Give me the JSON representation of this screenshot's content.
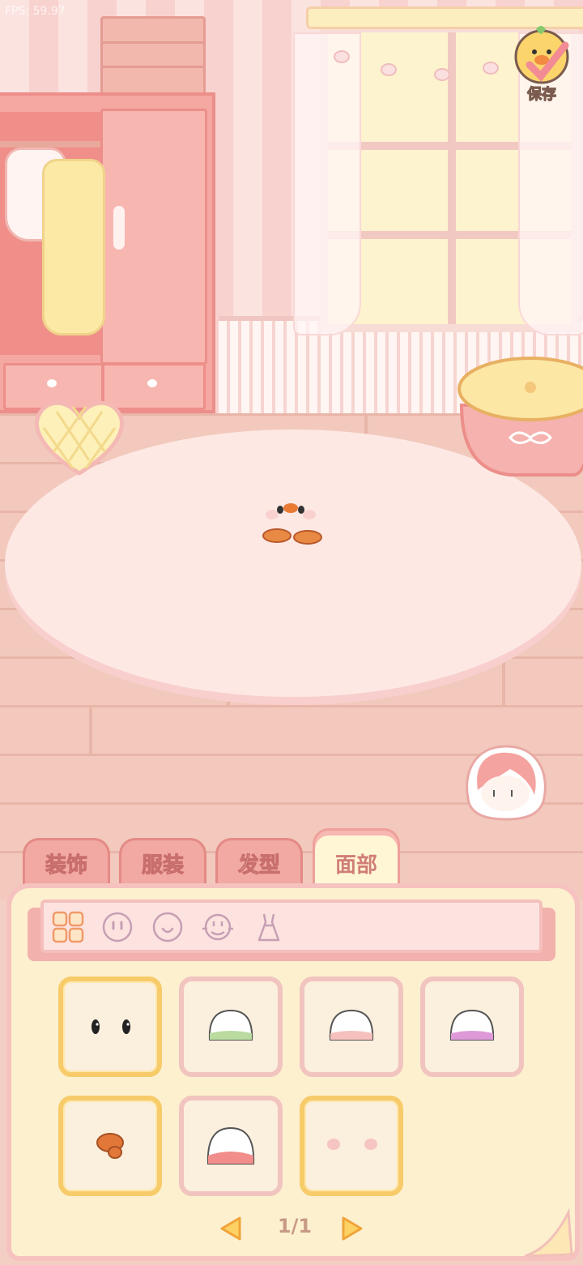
{
  "fps": "FPS: 59.97",
  "save": {
    "label": "保存",
    "icon": "duck-checkmark-icon"
  },
  "tabs": [
    {
      "label": "装饰"
    },
    {
      "label": "服装"
    },
    {
      "label": "发型"
    },
    {
      "label": "面部",
      "active": true
    }
  ],
  "subcategories": [
    {
      "icon": "grid-icon",
      "active": true
    },
    {
      "icon": "face-eyes-icon"
    },
    {
      "icon": "smile-icon"
    },
    {
      "icon": "face-blush-icon"
    },
    {
      "icon": "dress-icon"
    }
  ],
  "items": [
    {
      "name": "eyes-dots",
      "selected": true
    },
    {
      "name": "mochi-green",
      "selected": false
    },
    {
      "name": "mochi-pink",
      "selected": false
    },
    {
      "name": "mochi-purple",
      "selected": false
    },
    {
      "name": "beak-orange",
      "selected": true
    },
    {
      "name": "mochi-red",
      "selected": false
    },
    {
      "name": "cheek-blush",
      "selected": true
    }
  ],
  "pager": {
    "text": "1/1"
  },
  "colors": {
    "accent": "#f7cb6a",
    "tab": "#f2a8a3",
    "panel": "#fdf0cf"
  }
}
